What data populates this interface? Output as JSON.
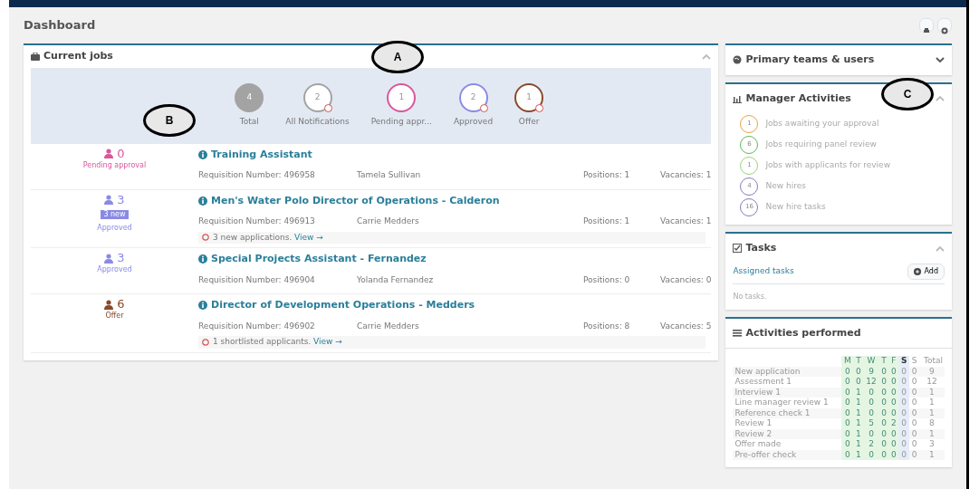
{
  "page": {
    "title": "Dashboard"
  },
  "callouts": [
    {
      "letter": "A"
    },
    {
      "letter": "B"
    },
    {
      "letter": "C"
    }
  ],
  "current_jobs": {
    "title": "Current jobs",
    "expanded": true,
    "stats": [
      {
        "kind": "filled",
        "count": "4",
        "label": "Total",
        "color": "#a3a3a3",
        "flagged": false
      },
      {
        "kind": "ring",
        "count": "2",
        "label": "All Notifications",
        "color": "#a3a3a3",
        "flagged": true
      },
      {
        "kind": "ring",
        "count": "1",
        "label": "Pending appr...",
        "color": "#d9579b",
        "flagged": false
      },
      {
        "kind": "ring",
        "count": "2",
        "label": "Approved",
        "color": "#8a8ae6",
        "flagged": true
      },
      {
        "kind": "ring",
        "count": "1",
        "label": "Offer",
        "color": "#8b4a2b",
        "flagged": true
      }
    ],
    "jobs": [
      {
        "count": "0",
        "status": "Pending approval",
        "color": "#d9579b",
        "title": "Training Assistant",
        "requisition": "Requisition Number: 496958",
        "person": "Tamela Sullivan",
        "positions": "Positions: 1",
        "vacancies": "Vacancies: 1"
      },
      {
        "count": "3",
        "badge": "3 new",
        "status": "Approved",
        "color": "#8a8ae6",
        "title": "Men's Water Polo Director of Operations - Calderon",
        "requisition": "Requisition Number: 496913",
        "person": "Carrie Medders",
        "positions": "Positions: 1",
        "vacancies": "Vacancies: 1",
        "note": "3 new applications.",
        "note_link": "View →"
      },
      {
        "count": "3",
        "status": "Approved",
        "color": "#8a8ae6",
        "title": "Special Projects Assistant - Fernandez",
        "requisition": "Requisition Number: 496904",
        "person": "Yolanda Fernandez",
        "positions": "Positions: 0",
        "vacancies": "Vacancies: 0"
      },
      {
        "count": "6",
        "status": "Offer",
        "color": "#8b4a2b",
        "title": "Director of Development Operations - Medders",
        "requisition": "Requisition Number: 496902",
        "person": "Carrie Medders",
        "positions": "Positions: 8",
        "vacancies": "Vacancies: 5",
        "note": "1 shortlisted applicants.",
        "note_link": "View →"
      }
    ]
  },
  "primary_teams": {
    "title": "Primary teams & users",
    "expanded": false
  },
  "manager_activities": {
    "title": "Manager Activities",
    "expanded": true,
    "items": [
      {
        "count": "1",
        "label": "Jobs awaiting your approval",
        "color": "#e8a33a"
      },
      {
        "count": "6",
        "label": "Jobs requiring panel review",
        "color": "#5cb85c"
      },
      {
        "count": "1",
        "label": "Jobs with applicants for review",
        "color": "#9ad27a"
      },
      {
        "count": "4",
        "label": "New hires",
        "color": "#8a7ab8"
      },
      {
        "count": "16",
        "label": "New hire tasks",
        "color": "#8a7ab8"
      }
    ]
  },
  "tasks": {
    "title": "Tasks",
    "expanded": true,
    "tab": "Assigned tasks",
    "add_button": "Add",
    "empty": "No tasks."
  },
  "activities_performed": {
    "title": "Activities performed",
    "days": [
      {
        "label": "M",
        "selected": false
      },
      {
        "label": "T",
        "selected": false
      },
      {
        "label": "W",
        "selected": false
      },
      {
        "label": "T",
        "selected": false
      },
      {
        "label": "F",
        "selected": false
      },
      {
        "label": "S",
        "selected": true
      },
      {
        "label": "S",
        "selected": false
      }
    ],
    "total_label": "Total",
    "rows": [
      {
        "name": "New application",
        "values": [
          "0",
          "0",
          "9",
          "0",
          "0",
          "0",
          "0"
        ],
        "total": "9"
      },
      {
        "name": "Assessment 1",
        "values": [
          "0",
          "0",
          "12",
          "0",
          "0",
          "0",
          "0"
        ],
        "total": "12"
      },
      {
        "name": "Interview 1",
        "values": [
          "0",
          "1",
          "0",
          "0",
          "0",
          "0",
          "0"
        ],
        "total": "1"
      },
      {
        "name": "Line manager review 1",
        "values": [
          "0",
          "1",
          "0",
          "0",
          "0",
          "0",
          "0"
        ],
        "total": "1"
      },
      {
        "name": "Reference check 1",
        "values": [
          "0",
          "1",
          "0",
          "0",
          "0",
          "0",
          "0"
        ],
        "total": "1"
      },
      {
        "name": "Review 1",
        "values": [
          "0",
          "1",
          "5",
          "0",
          "2",
          "0",
          "0"
        ],
        "total": "8"
      },
      {
        "name": "Review 2",
        "values": [
          "0",
          "1",
          "0",
          "0",
          "0",
          "0",
          "0"
        ],
        "total": "1"
      },
      {
        "name": "Offer made",
        "values": [
          "0",
          "1",
          "2",
          "0",
          "0",
          "0",
          "0"
        ],
        "total": "3"
      },
      {
        "name": "Pre-offer check",
        "values": [
          "0",
          "1",
          "0",
          "0",
          "0",
          "0",
          "0"
        ],
        "total": "1"
      }
    ]
  }
}
